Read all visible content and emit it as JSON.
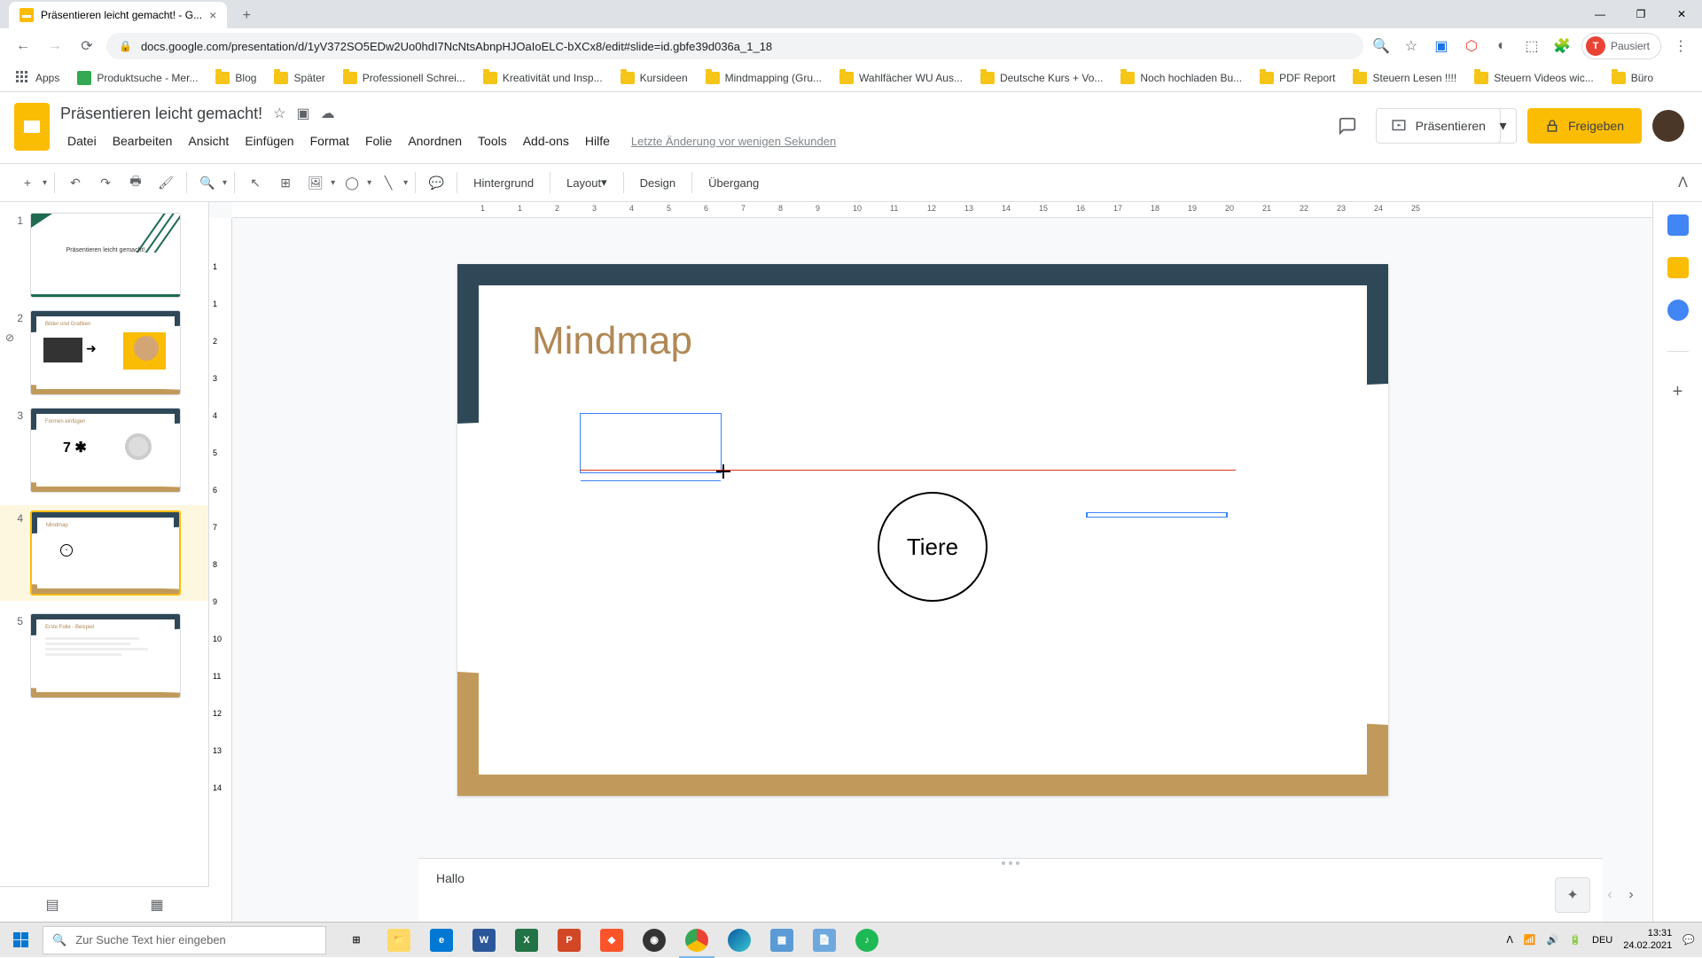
{
  "browser": {
    "tab_title": "Präsentieren leicht gemacht! - G...",
    "url": "docs.google.com/presentation/d/1yV372SO5EDw2Uo0hdI7NcNtsAbnpHJOaIoELC-bXCx8/edit#slide=id.gbfe39d036a_1_18",
    "profile_state": "Pausiert",
    "profile_initial": "T"
  },
  "bookmarks": [
    {
      "label": "Apps",
      "type": "apps"
    },
    {
      "label": "Produktsuche - Mer...",
      "type": "site"
    },
    {
      "label": "Blog",
      "type": "folder"
    },
    {
      "label": "Später",
      "type": "folder"
    },
    {
      "label": "Professionell Schrei...",
      "type": "folder"
    },
    {
      "label": "Kreativität und Insp...",
      "type": "folder"
    },
    {
      "label": "Kursideen",
      "type": "folder"
    },
    {
      "label": "Mindmapping  (Gru...",
      "type": "folder"
    },
    {
      "label": "Wahlfächer WU Aus...",
      "type": "folder"
    },
    {
      "label": "Deutsche Kurs + Vo...",
      "type": "folder"
    },
    {
      "label": "Noch hochladen Bu...",
      "type": "folder"
    },
    {
      "label": "PDF Report",
      "type": "folder"
    },
    {
      "label": "Steuern Lesen !!!!",
      "type": "folder"
    },
    {
      "label": "Steuern Videos wic...",
      "type": "folder"
    },
    {
      "label": "Büro",
      "type": "folder"
    }
  ],
  "doc": {
    "title": "Präsentieren leicht gemacht!",
    "last_edit": "Letzte Änderung vor wenigen Sekunden"
  },
  "menus": [
    "Datei",
    "Bearbeiten",
    "Ansicht",
    "Einfügen",
    "Format",
    "Folie",
    "Anordnen",
    "Tools",
    "Add-ons",
    "Hilfe"
  ],
  "header_buttons": {
    "present": "Präsentieren",
    "share": "Freigeben"
  },
  "toolbar": {
    "background": "Hintergrund",
    "layout": "Layout",
    "design": "Design",
    "transition": "Übergang"
  },
  "slides": [
    {
      "num": "1",
      "title": "Präsentieren leicht gemacht!"
    },
    {
      "num": "2",
      "title": "Bilder und Grafiken"
    },
    {
      "num": "3",
      "title": "Formen einfügen",
      "extra": "7 ✱"
    },
    {
      "num": "4",
      "title": "Mindmap"
    },
    {
      "num": "5",
      "title": "Erste Folie - Beispiel"
    }
  ],
  "current_slide": {
    "title": "Mindmap",
    "circle_text": "Tiere"
  },
  "notes": {
    "text": "Hallo"
  },
  "ruler_h": [
    "1",
    "1",
    "2",
    "3",
    "4",
    "5",
    "6",
    "7",
    "8",
    "9",
    "10",
    "11",
    "12",
    "13",
    "14",
    "15",
    "16",
    "17",
    "18",
    "19",
    "20",
    "21",
    "22",
    "23",
    "24",
    "25"
  ],
  "ruler_v": [
    "1",
    "1",
    "2",
    "3",
    "4",
    "5",
    "6",
    "7",
    "8",
    "9",
    "10",
    "11",
    "12",
    "13",
    "14"
  ],
  "taskbar": {
    "search_placeholder": "Zur Suche Text hier eingeben",
    "lang": "DEU",
    "time": "13:31",
    "date": "24.02.2021"
  }
}
